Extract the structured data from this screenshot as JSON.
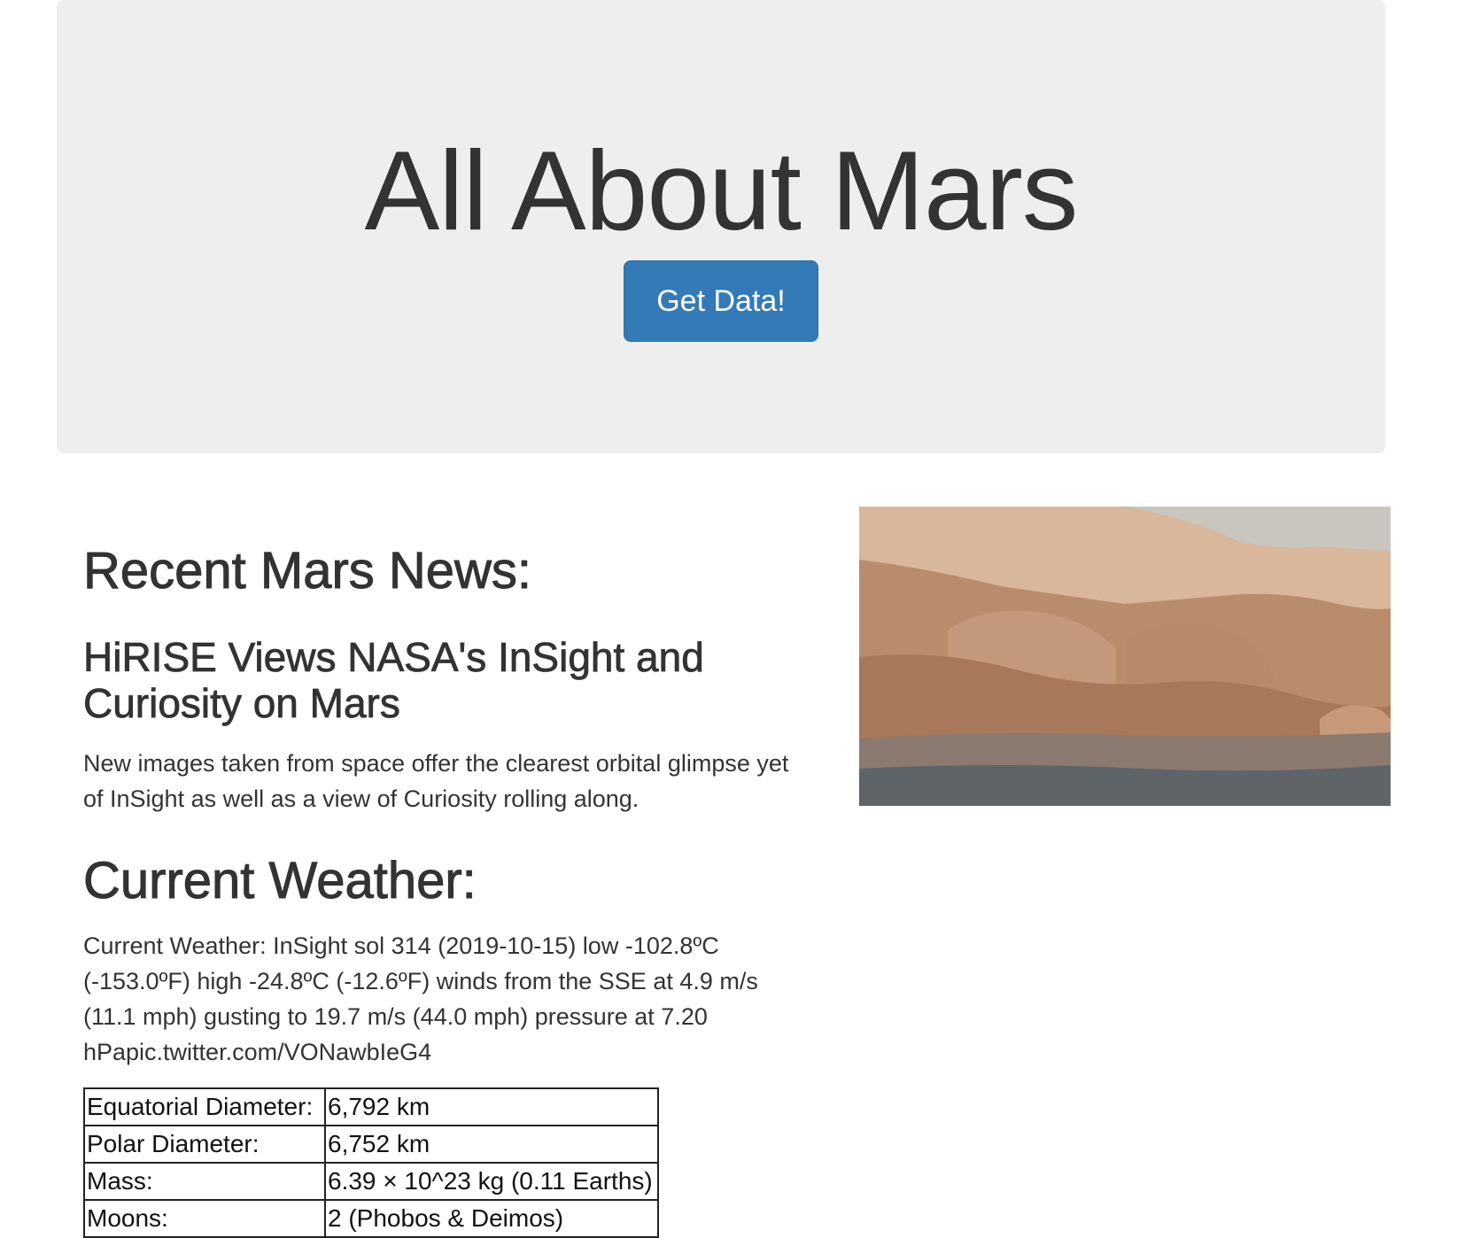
{
  "header": {
    "title": "All About Mars",
    "button_label": "Get Data!"
  },
  "news": {
    "section_heading": "Recent Mars News:",
    "title": "HiRISE Views NASA's InSight and Curiosity on Mars",
    "paragraph": "New images taken from space offer the clearest orbital glimpse yet of InSight as well as a view of Curiosity rolling along."
  },
  "weather": {
    "section_heading": "Current Weather:",
    "text": "Current Weather: InSight sol 314 (2019-10-15) low -102.8ºC (-153.0ºF) high -24.8ºC (-12.6ºF) winds from the SSE at 4.9 m/s (11.1 mph) gusting to 19.7 m/s (44.0 mph) pressure at 7.20 hPapic.twitter.com/VONawbIeG4"
  },
  "facts": {
    "rows": [
      {
        "label": "Equatorial Diameter:",
        "value": "6,792 km"
      },
      {
        "label": "Polar Diameter:",
        "value": "6,752 km"
      },
      {
        "label": "Mass:",
        "value": "6.39 × 10^23 kg (0.11 Earths)"
      },
      {
        "label": "Moons:",
        "value": "2 (Phobos & Deimos)"
      }
    ]
  },
  "featured_image": {
    "colors": {
      "sky": "#c9c6c0",
      "far_hills": "#d8b79a",
      "mid_hills": "#b98d6c",
      "near_hills": "#a7785a",
      "ground": "#8a7a70",
      "dark_ground": "#5f6468"
    }
  }
}
